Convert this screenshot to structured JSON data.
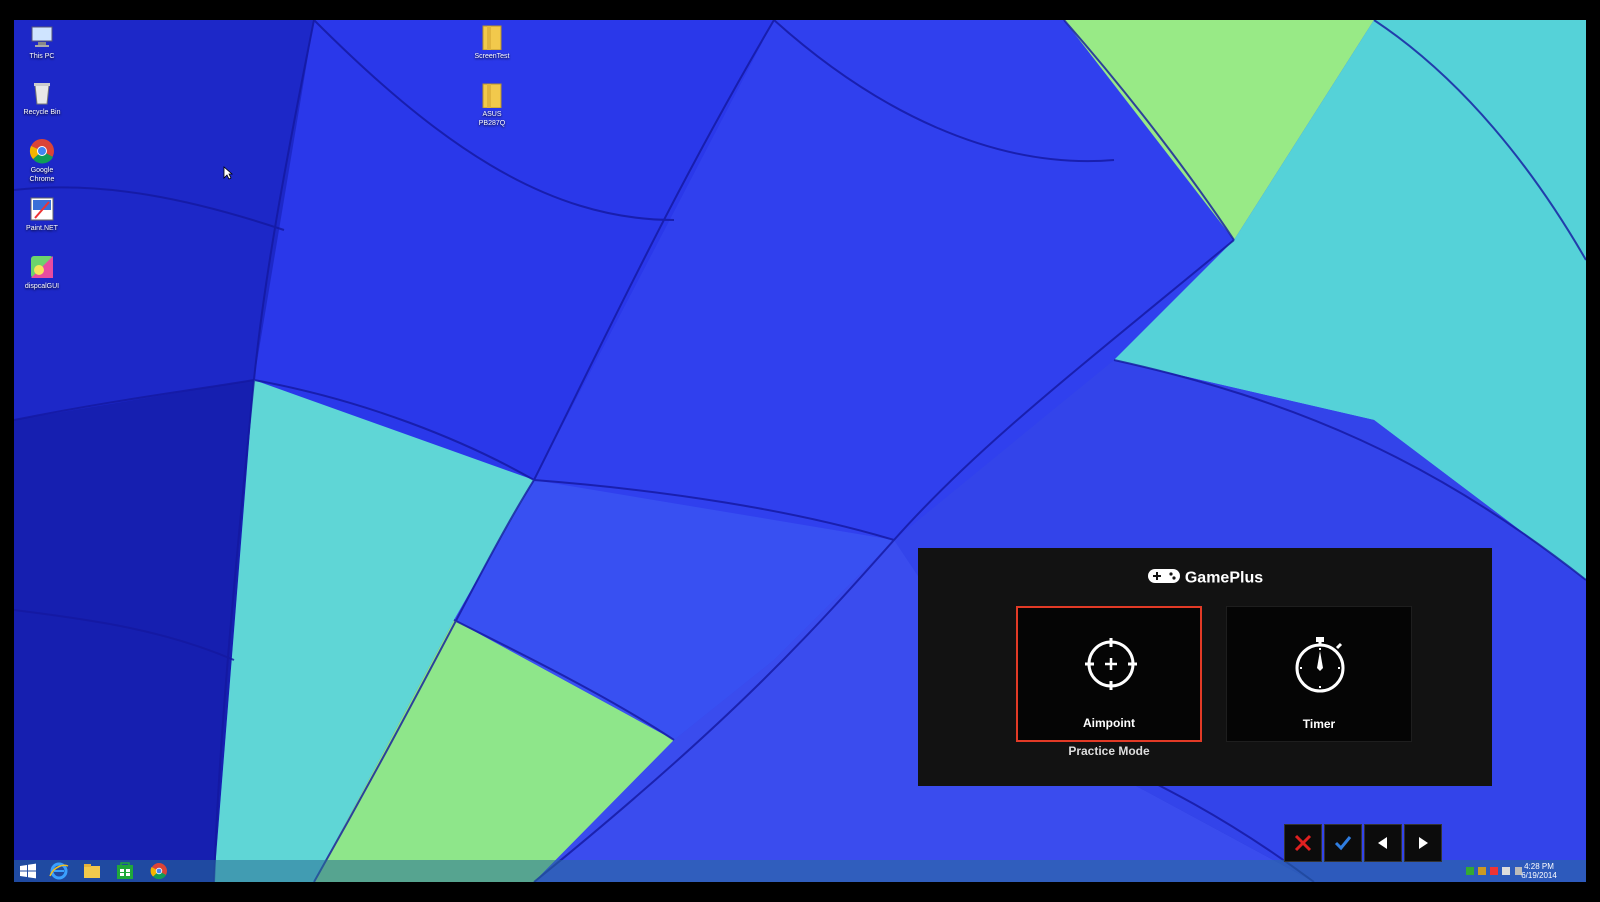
{
  "desktop": {
    "icons": [
      {
        "label_line1": "This PC",
        "label_line2": ""
      },
      {
        "label_line1": "Recycle Bin",
        "label_line2": ""
      },
      {
        "label_line1": "Google",
        "label_line2": "Chrome"
      },
      {
        "label_line1": "Paint.NET",
        "label_line2": ""
      },
      {
        "label_line1": "dispcalGUI",
        "label_line2": ""
      },
      {
        "label_line1": "ScreenTest",
        "label_line2": ""
      },
      {
        "label_line1": "ASUS",
        "label_line2": "PB287Q"
      }
    ]
  },
  "taskbar": {
    "pinned": [
      "start-icon",
      "internet-explorer-icon",
      "file-explorer-icon",
      "store-icon",
      "chrome-icon"
    ],
    "clock": {
      "time": "4:28 PM",
      "date": "6/19/2014"
    }
  },
  "osd_nav": {
    "buttons": [
      "close-icon",
      "check-icon",
      "left-arrow-icon",
      "right-arrow-icon"
    ],
    "close_color": "#e02020",
    "check_color": "#2f7de0"
  },
  "gameplus": {
    "title": "GamePlus",
    "options": [
      {
        "label": "Aimpoint",
        "icon": "crosshair-icon",
        "selected": true
      },
      {
        "label": "Timer",
        "icon": "stopwatch-icon",
        "selected": false
      }
    ],
    "footer": "Practice Mode",
    "highlight_color": "#e23a26"
  }
}
